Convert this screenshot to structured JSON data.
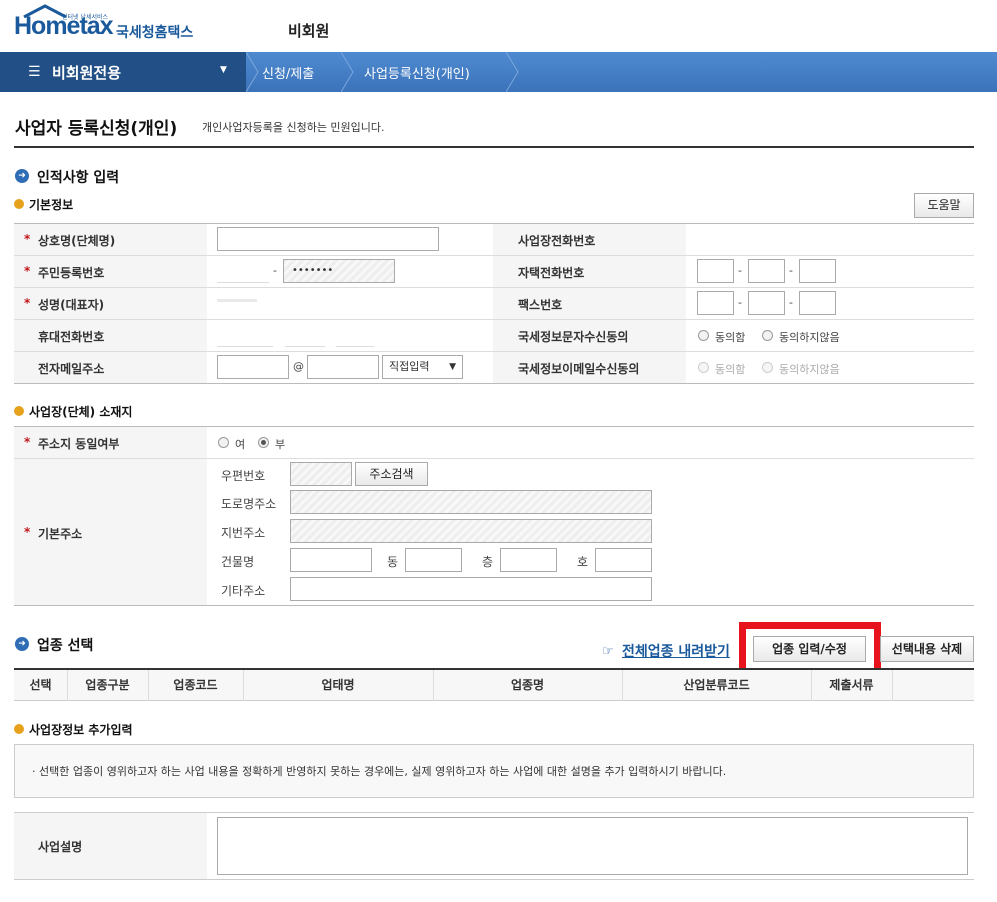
{
  "header": {
    "logo_text": "Hometax",
    "logo_kr": "국세청홈택스",
    "logo_tagline": "인터넷 납세서비스",
    "member_type": "비회원"
  },
  "nav": {
    "menu_label": "비회원전용",
    "crumbs": [
      "신청/제출",
      "사업등록신청(개인)"
    ]
  },
  "page": {
    "title": "사업자 등록신청(개인)",
    "description": "개인사업자등록을 신청하는 민원입니다."
  },
  "sections": {
    "personal": "인적사항 입력",
    "basic": "기본정보",
    "location": "사업장(단체) 소재지",
    "industry": "업종 선택",
    "extra": "사업장정보 추가입력"
  },
  "buttons": {
    "help": "도움말",
    "address_search": "주소검색",
    "industry_edit": "업종 입력/수정",
    "delete_selected": "선택내용 삭제",
    "download_all": "전체업종 내려받기"
  },
  "basic": {
    "trade_name": "상호명(단체명)",
    "rrn": "주민등록번호",
    "rrn_mask": "•••••••",
    "name": "성명(대표자)",
    "mobile": "휴대전화번호",
    "email": "전자메일주소",
    "email_at": "@",
    "email_domain": "직접입력",
    "biz_phone": "사업장전화번호",
    "home_phone": "자택전화번호",
    "fax": "팩스번호",
    "sms_consent": "국세정보문자수신동의",
    "email_consent": "국세정보이메일수신동의",
    "agree": "동의함",
    "disagree": "동의하지않음",
    "dash": "-"
  },
  "location": {
    "same_addr": "주소지 동일여부",
    "yes": "여",
    "no": "부",
    "base_addr": "기본주소",
    "postal": "우편번호",
    "road": "도로명주소",
    "lot": "지번주소",
    "building": "건물명",
    "dong": "동",
    "floor": "층",
    "ho": "호",
    "other": "기타주소"
  },
  "table": {
    "headers": [
      "선택",
      "업종구분",
      "업종코드",
      "업태명",
      "업종명",
      "산업분류코드",
      "제출서류"
    ]
  },
  "extra": {
    "notice": "선택한 업종이 영위하고자 하는 사업 내용을 정확하게 반영하지 못하는 경우에는, 실제 영위하고자 하는 사업에 대한 설명을 추가 입력하시기 바랍니다.",
    "desc_label": "사업설명"
  },
  "colors": {
    "nav_blue": "#3b73ba",
    "nav_dark": "#214f86",
    "highlight": "#e8141d",
    "required": "#c0161b"
  }
}
